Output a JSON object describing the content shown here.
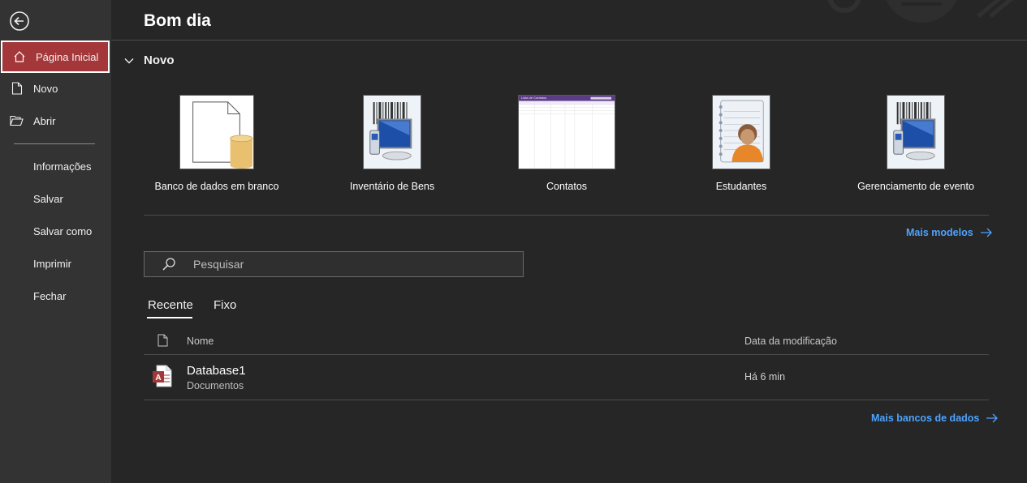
{
  "greeting": "Bom dia",
  "accent_color": "#a4373a",
  "link_color": "#4da3ff",
  "sidebar": {
    "back_icon": "back-arrow-icon",
    "items": [
      {
        "label": "Página Inicial",
        "icon": "home-icon",
        "active": true
      },
      {
        "label": "Novo",
        "icon": "new-document-icon"
      },
      {
        "label": "Abrir",
        "icon": "folder-open-icon"
      },
      {
        "label": "Informações"
      },
      {
        "label": "Salvar"
      },
      {
        "label": "Salvar como"
      },
      {
        "label": "Imprimir"
      },
      {
        "label": "Fechar"
      }
    ]
  },
  "new_section": {
    "title": "Novo",
    "templates": [
      {
        "label": "Banco de dados em branco",
        "icon": "blank-database-icon"
      },
      {
        "label": "Inventário de Bens",
        "icon": "barcode-computer-icon"
      },
      {
        "label": "Contatos",
        "icon": "contact-list-preview",
        "preview_title": "Lista de Contatos"
      },
      {
        "label": "Estudantes",
        "icon": "student-notebook-icon"
      },
      {
        "label": "Gerenciamento de evento",
        "icon": "barcode-computer-icon"
      }
    ],
    "more_link": "Mais modelos"
  },
  "search": {
    "placeholder": "Pesquisar",
    "value": ""
  },
  "tabs": [
    {
      "label": "Recente",
      "active": true
    },
    {
      "label": "Fixo",
      "active": false
    }
  ],
  "table": {
    "columns": [
      "Nome",
      "Data da modificação"
    ],
    "rows": [
      {
        "name": "Database1",
        "location": "Documentos",
        "modified": "Há 6 min",
        "icon": "access-file-icon"
      }
    ]
  },
  "more_databases_link": "Mais bancos de dados"
}
